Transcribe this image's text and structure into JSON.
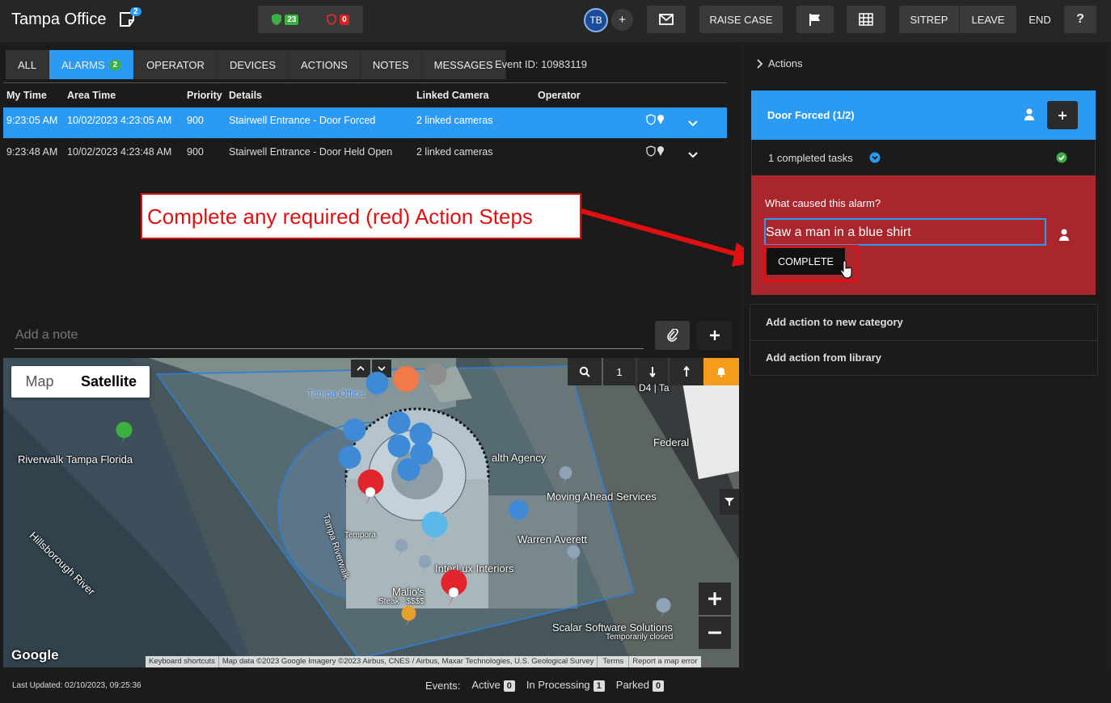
{
  "header": {
    "title": "Tampa Office",
    "note_count": "2",
    "shield_ok_count": "23",
    "shield_alert_count": "0",
    "avatar_initials": "TB",
    "plus": "+",
    "raise_case": "RAISE CASE",
    "sitrep": "SITREP",
    "leave": "LEAVE",
    "end": "END",
    "help": "?"
  },
  "tabs": [
    {
      "label": "ALL"
    },
    {
      "label": "ALARMS",
      "badge": "2"
    },
    {
      "label": "OPERATOR"
    },
    {
      "label": "DEVICES"
    },
    {
      "label": "ACTIONS"
    },
    {
      "label": "NOTES"
    },
    {
      "label": "MESSAGES"
    }
  ],
  "event_id": "Event ID: 10983119",
  "table": {
    "columns": [
      "My Time",
      "Area Time",
      "Priority",
      "Details",
      "Linked Camera",
      "Operator"
    ],
    "rows": [
      {
        "my_time": "9:23:05 AM",
        "area_time": "10/02/2023 4:23:05 AM",
        "priority": "900",
        "details": "Stairwell Entrance - Door Forced",
        "linked": "2 linked cameras",
        "operator": ""
      },
      {
        "my_time": "9:23:48 AM",
        "area_time": "10/02/2023 4:23:48 AM",
        "priority": "900",
        "details": "Stairwell Entrance - Door Held Open",
        "linked": "2 linked cameras",
        "operator": ""
      }
    ]
  },
  "callout": "Complete any required (red) Action Steps",
  "note": {
    "placeholder": "Add a note"
  },
  "map": {
    "type_map": "Map",
    "type_satellite": "Satellite",
    "floor": "1",
    "attribution": {
      "shortcuts": "Keyboard shortcuts",
      "data": "Map data ©2023 Google Imagery ©2023 Airbus, CNES / Airbus, Maxar Technologies, U.S. Geological Survey",
      "terms": "Terms",
      "report": "Report a map error"
    },
    "labels": {
      "tampa": "Tampa Office",
      "riverwalk": "Riverwalk Tampa Florida",
      "river": "Hillsborough River",
      "health": "alth Agency",
      "moving": "Moving Ahead Services",
      "warren": "Warren Averett",
      "interlux": "InterLux Interiors",
      "malios": "Malio's",
      "steak": "Steak · $$$$",
      "scalar": "Scalar Software Solutions",
      "closed": "Temporarily closed",
      "federal": "Federal",
      "d4": "D4 | Ta",
      "tampa_rw": "Tampa Riverwalk",
      "tempora": "Tempora",
      "google": "Google"
    }
  },
  "actions": {
    "header": "Actions",
    "group_title": "Door Forced (1/2)",
    "completed": "1 completed tasks",
    "question": "What caused this alarm?",
    "answer": "Saw a man in a blue shirt",
    "complete": "COMPLETE",
    "add_new": "Add action to new category",
    "add_library": "Add action from library"
  },
  "status": {
    "last_updated": "Last Updated: 02/10/2023, 09:25:36",
    "events": "Events:",
    "active": "Active",
    "active_n": "0",
    "processing": "In Processing",
    "processing_n": "1",
    "parked": "Parked",
    "parked_n": "0"
  },
  "colors": {
    "accent": "#2b9af3",
    "alert": "#a8262c",
    "success": "#3cb043",
    "callout_red": "#e01010"
  }
}
